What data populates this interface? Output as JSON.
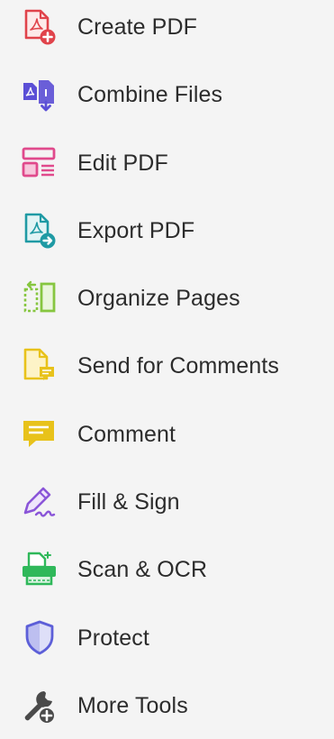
{
  "tools": [
    {
      "key": "create-pdf",
      "label": "Create PDF",
      "icon": "create-pdf-icon",
      "color": "#e0434b"
    },
    {
      "key": "combine-files",
      "label": "Combine Files",
      "icon": "combine-files-icon",
      "color": "#6a5ed8"
    },
    {
      "key": "edit-pdf",
      "label": "Edit PDF",
      "icon": "edit-pdf-icon",
      "color": "#e04a8c"
    },
    {
      "key": "export-pdf",
      "label": "Export PDF",
      "icon": "export-pdf-icon",
      "color": "#1f9aa4"
    },
    {
      "key": "organize-pages",
      "label": "Organize Pages",
      "icon": "organize-pages-icon",
      "color": "#86c640"
    },
    {
      "key": "send-for-comments",
      "label": "Send for Comments",
      "icon": "send-for-comments-icon",
      "color": "#e8c21a"
    },
    {
      "key": "comment",
      "label": "Comment",
      "icon": "comment-icon",
      "color": "#e8c21a"
    },
    {
      "key": "fill-sign",
      "label": "Fill & Sign",
      "icon": "fill-sign-icon",
      "color": "#8a55d8"
    },
    {
      "key": "scan-ocr",
      "label": "Scan & OCR",
      "icon": "scan-ocr-icon",
      "color": "#2fb85a"
    },
    {
      "key": "protect",
      "label": "Protect",
      "icon": "shield-icon",
      "color": "#5d5fd8"
    },
    {
      "key": "more-tools",
      "label": "More Tools",
      "icon": "more-tools-icon",
      "color": "#4a4a4a"
    }
  ]
}
